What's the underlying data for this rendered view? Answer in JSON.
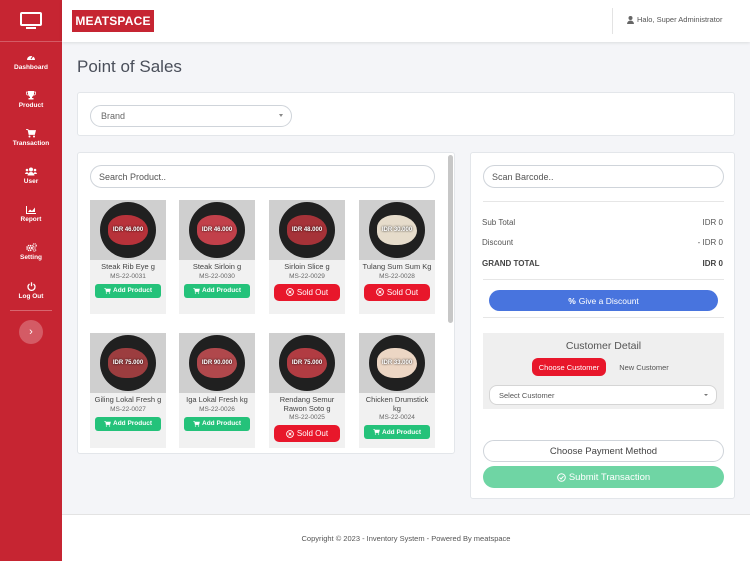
{
  "app": {
    "brand": "MEATSPACE",
    "user_greeting": "Halo, Super Administrator"
  },
  "sidebar": {
    "items": [
      {
        "label": "Dashboard",
        "icon": "dashboard-icon"
      },
      {
        "label": "Product",
        "icon": "trophy-icon"
      },
      {
        "label": "Transaction",
        "icon": "cart-icon"
      },
      {
        "label": "User",
        "icon": "users-icon"
      },
      {
        "label": "Report",
        "icon": "chart-icon"
      },
      {
        "label": "Setting",
        "icon": "gears-icon"
      },
      {
        "label": "Log Out",
        "icon": "power-icon"
      }
    ],
    "toggle": "›"
  },
  "page": {
    "title": "Point of Sales"
  },
  "brand_filter": {
    "placeholder": "Brand"
  },
  "search": {
    "placeholder": "Search Product.."
  },
  "products": [
    {
      "name": "Steak Rib Eye g",
      "code": "MS-22-0031",
      "price": "IDR 46.000",
      "status": "add",
      "action": "Add Product",
      "meat": "#b8323a"
    },
    {
      "name": "Steak Sirloin g",
      "code": "MS-22-0030",
      "price": "IDR 46.000",
      "status": "add",
      "action": "Add Product",
      "meat": "#c2404a"
    },
    {
      "name": "Sirloin Slice g",
      "code": "MS-22-0029",
      "price": "IDR 48.000",
      "status": "sold",
      "action": "Sold Out",
      "meat": "#a63238"
    },
    {
      "name": "Tulang Sum Sum Kg",
      "code": "MS-22-0028",
      "price": "IDR 30.000",
      "status": "sold",
      "action": "Sold Out",
      "meat": "#e6dccb"
    },
    {
      "name": "Giling Lokal Fresh g",
      "code": "MS-22-0027",
      "price": "IDR 75.000",
      "status": "add",
      "action": "Add Product",
      "meat": "#9c3d3f"
    },
    {
      "name": "Iga Lokal Fresh kg",
      "code": "MS-22-0026",
      "price": "IDR 90.000",
      "status": "add",
      "action": "Add Product",
      "meat": "#b0484c"
    },
    {
      "name": "Rendang Semur Rawon Soto g",
      "code": "MS-22-0025",
      "price": "IDR 75.000",
      "status": "sold",
      "action": "Sold Out",
      "meat": "#b13c42"
    },
    {
      "name": "Chicken Drumstick kg",
      "code": "MS-22-0024",
      "price": "IDR 33.000",
      "status": "add",
      "action": "Add Product",
      "meat": "#ecd6c4"
    }
  ],
  "cart": {
    "barcode_placeholder": "Scan Barcode..",
    "sub_total_label": "Sub Total",
    "sub_total": "IDR 0",
    "discount_label": "Discount",
    "discount": "- IDR 0",
    "grand_total_label": "GRAND TOTAL",
    "grand_total": "IDR 0",
    "discount_button": "Give a Discount"
  },
  "customer": {
    "title": "Customer Detail",
    "choose_button": "Choose Customer",
    "new_button": "New Customer",
    "select_placeholder": "Select Customer"
  },
  "payment": {
    "method_button": "Choose Payment Method",
    "submit_button": "Submit Transaction"
  },
  "footer": {
    "text": "Copyright © 2023 - Inventory System - Powered By meatspace"
  }
}
